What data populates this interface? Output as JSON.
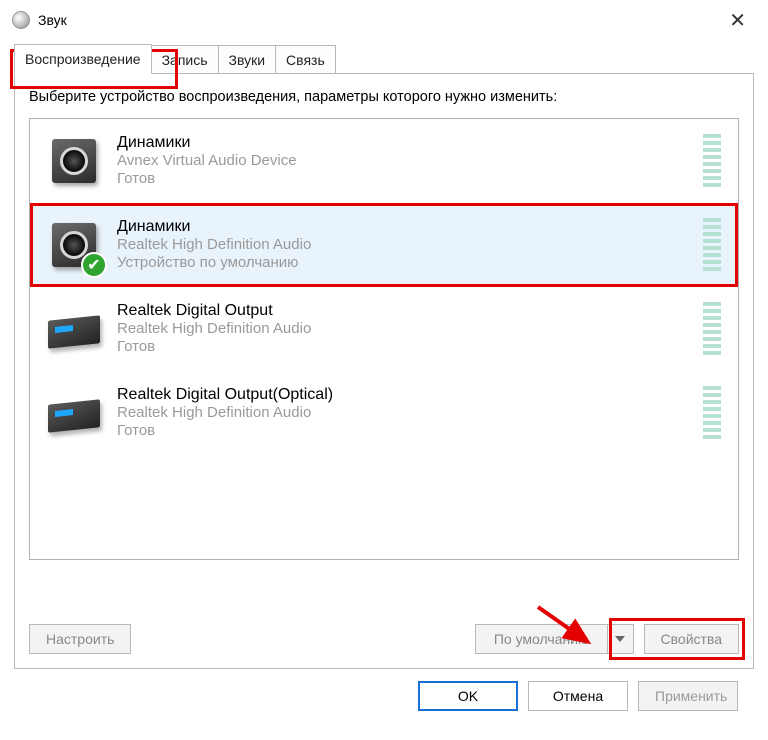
{
  "window": {
    "title": "Звук"
  },
  "tabs": [
    {
      "label": "Воспроизведение",
      "active": true
    },
    {
      "label": "Запись",
      "active": false
    },
    {
      "label": "Звуки",
      "active": false
    },
    {
      "label": "Связь",
      "active": false
    }
  ],
  "panel": {
    "prompt": "Выберите устройство воспроизведения, параметры которого нужно изменить:"
  },
  "devices": [
    {
      "name": "Динамики",
      "driver": "Avnex Virtual Audio Device",
      "status": "Готов",
      "kind": "speaker",
      "default": false,
      "selected": false
    },
    {
      "name": "Динамики",
      "driver": "Realtek High Definition Audio",
      "status": "Устройство по умолчанию",
      "kind": "speaker",
      "default": true,
      "selected": true
    },
    {
      "name": "Realtek Digital Output",
      "driver": "Realtek High Definition Audio",
      "status": "Готов",
      "kind": "digital",
      "default": false,
      "selected": false
    },
    {
      "name": "Realtek Digital Output(Optical)",
      "driver": "Realtek High Definition Audio",
      "status": "Готов",
      "kind": "digital",
      "default": false,
      "selected": false
    }
  ],
  "buttons": {
    "configure": "Настроить",
    "set_default": "По умолчанию",
    "properties": "Свойства",
    "ok": "OK",
    "cancel": "Отмена",
    "apply": "Применить"
  },
  "annotations": {
    "highlight_tab_index": 0,
    "highlight_device_index": 1,
    "highlight_properties_button": true,
    "arrow_to_properties": true
  }
}
